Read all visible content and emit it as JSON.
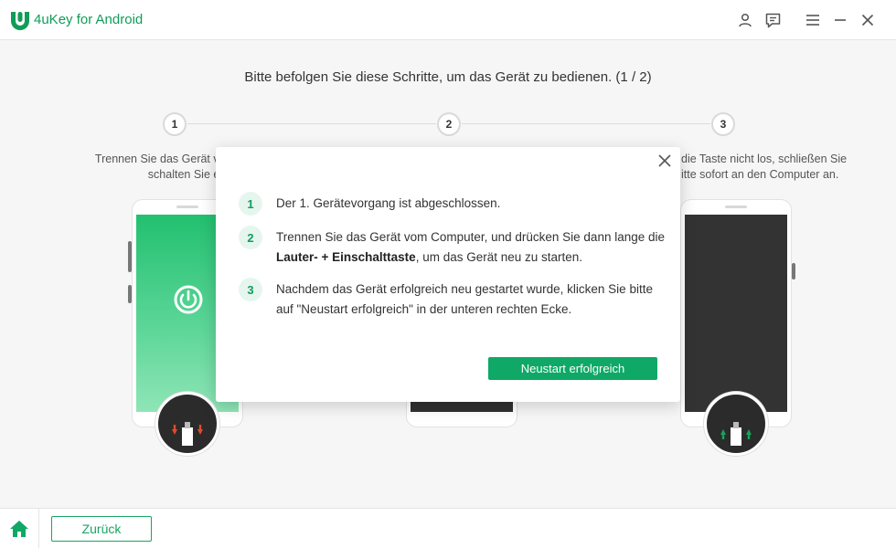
{
  "app": {
    "title": "4uKey for Android",
    "brand_color": "#0f9d58"
  },
  "titlebar": {
    "icons": [
      "user-icon",
      "feedback-icon",
      "menu-icon",
      "minimize-icon",
      "close-icon"
    ]
  },
  "main": {
    "heading": "Bitte befolgen Sie diese Schritte, um das Gerät zu bedienen. (1 / 2)",
    "steps": [
      {
        "number": "1",
        "desc_line1": "Trennen Sie das Gerät vom",
        "desc_line2": "schalten Sie es a"
      },
      {
        "number": "2"
      },
      {
        "number": "3",
        "desc_line1": "die Taste nicht los, schließen Sie",
        "desc_line2": "itte sofort an den Computer an."
      }
    ]
  },
  "dialog": {
    "items": [
      {
        "number": "1",
        "text": "Der 1. Gerätevorgang ist abgeschlossen."
      },
      {
        "number": "2",
        "text_before": "Trennen Sie das Gerät vom Computer, und drücken Sie dann lange die ",
        "bold": "Lauter- + Einschalttaste",
        "text_after": ", um das Gerät neu zu starten."
      },
      {
        "number": "3",
        "text": "Nachdem das Gerät erfolgreich neu gestartet wurde, klicken Sie bitte auf \"Neustart erfolgreich\" in der unteren rechten Ecke."
      }
    ],
    "button_label": "Neustart erfolgreich",
    "button_color": "#0fa866"
  },
  "footer": {
    "back_label": "Zurück"
  }
}
